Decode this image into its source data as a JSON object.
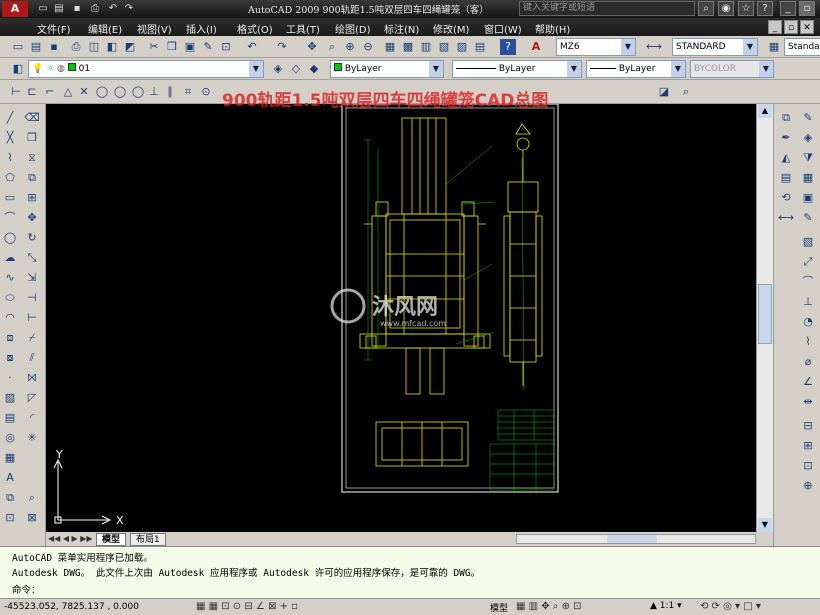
{
  "titlebar": {
    "app_icon": "A",
    "title": "AutoCAD 2009  900轨距1.5吨双层四车四绳罐笼（客）",
    "search_placeholder": "键入关键字或短语",
    "quick_access_icons": [
      "new-icon",
      "open-icon",
      "save-icon",
      "print-icon",
      "undo-icon",
      "redo-icon"
    ],
    "right_buttons": [
      "search-icon",
      "comm-center-icon",
      "favorites-icon",
      "help-icon"
    ],
    "window_controls": [
      "minimize",
      "maximize",
      "close"
    ]
  },
  "menubar": {
    "items": [
      "文件(F)",
      "编辑(E)",
      "视图(V)",
      "插入(I)",
      "格式(O)",
      "工具(T)",
      "绘图(D)",
      "标注(N)",
      "修改(M)",
      "窗口(W)",
      "帮助(H)"
    ],
    "doc_controls": [
      "_",
      "▫",
      "✕"
    ]
  },
  "standard_toolbar": {
    "text_style": "MZ6",
    "dim_style": "STANDARD",
    "table_style": "Standar"
  },
  "layers_toolbar": {
    "current_layer": "01",
    "color": "ByLayer",
    "linetype": "ByLayer",
    "lineweight": "ByLayer",
    "plot_style": "BYCOLOR"
  },
  "watermark": {
    "text": "900轨距1.5吨双层四车四绳罐笼CAD总图",
    "logo_text": "沐风网",
    "logo_url": "www.mfcad.com"
  },
  "canvas": {
    "ucs_x": "X",
    "ucs_y": "Y",
    "colors": {
      "background": "#000000",
      "drawing": "#e8e800",
      "frame": "#ffffff",
      "detail": "#00c800"
    }
  },
  "tabs": {
    "model": "模型",
    "layout1": "布局1"
  },
  "command": {
    "line1": "AutoCAD 菜单实用程序已加载。",
    "line2": "Autodesk DWG。   此文件上次由 Autodesk 应用程序或 Autodesk 许可的应用程序保存，是可靠的 DWG。",
    "prompt": "命令："
  },
  "status": {
    "coords": "-45523.052,  7825.137 , 0.000",
    "model_label": "模型",
    "scale": "1:1"
  }
}
